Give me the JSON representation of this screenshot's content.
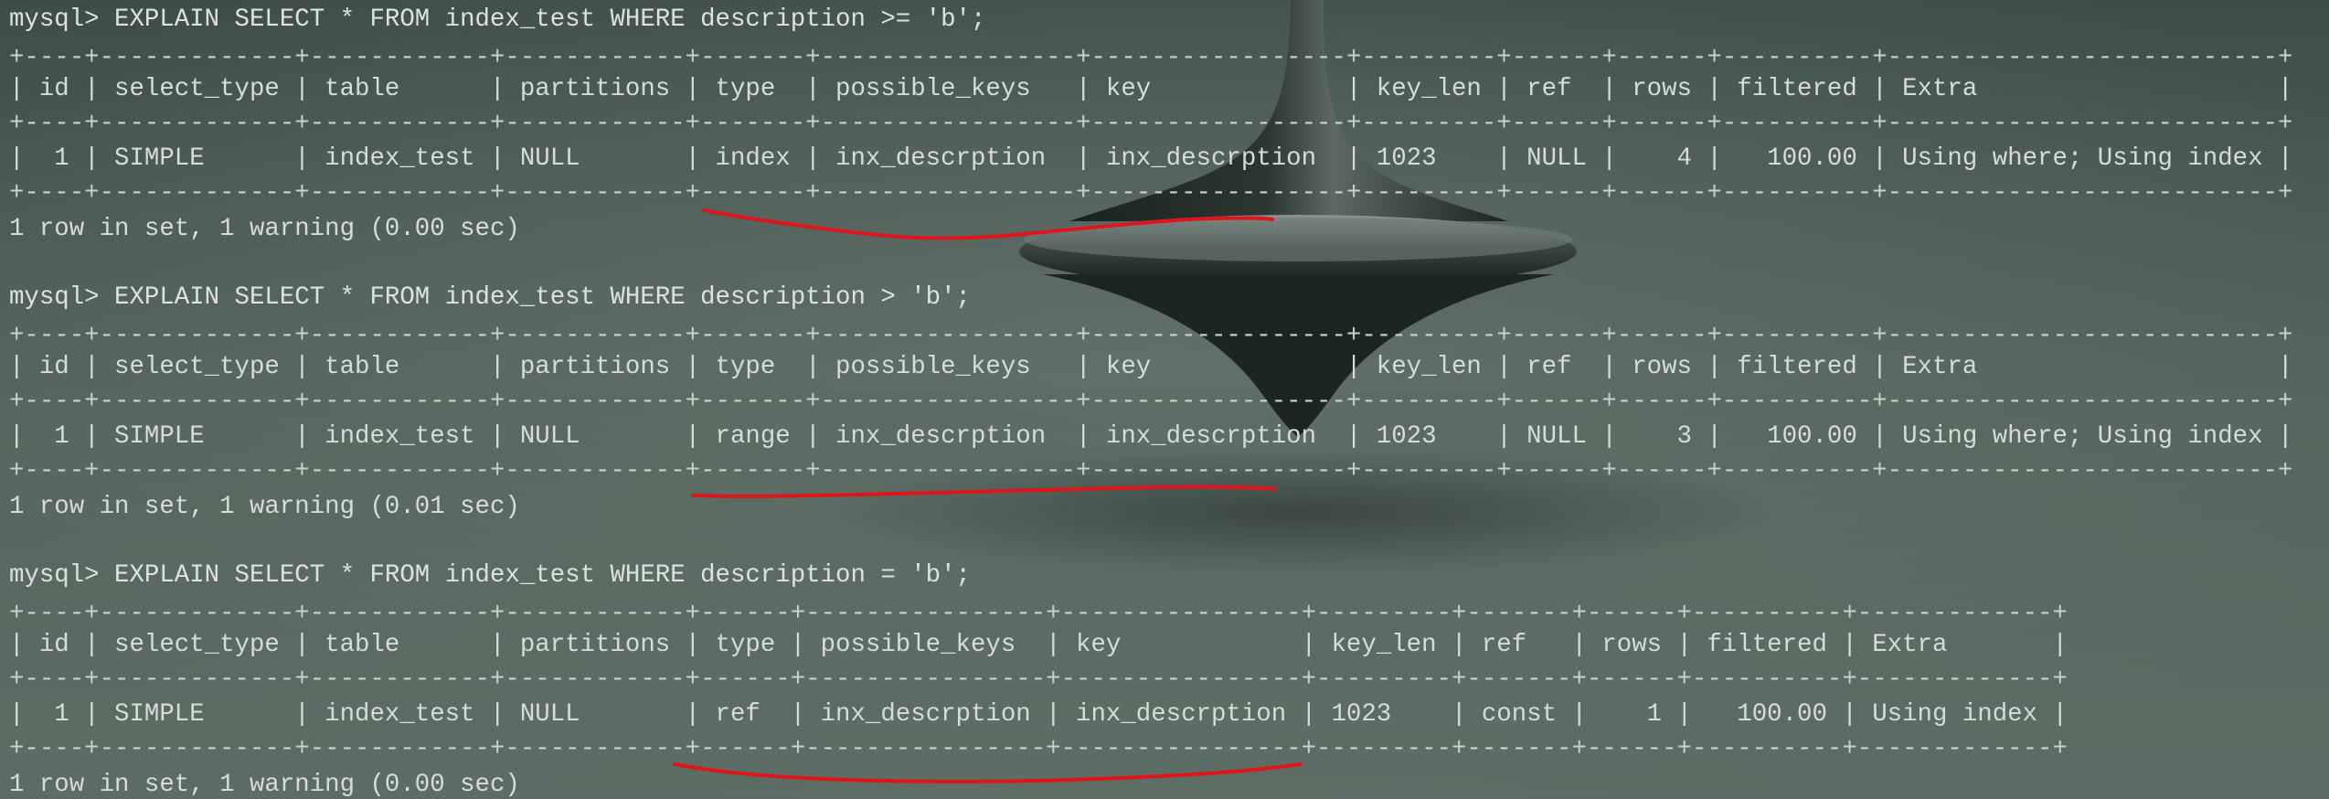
{
  "terminal": {
    "lines": [
      "mysql> EXPLAIN SELECT * FROM index_test WHERE description >= 'b';",
      "+----+-------------+------------+------------+-------+-----------------+-----------------+---------+------+------+----------+--------------------------+",
      "| id | select_type | table      | partitions | type  | possible_keys   | key             | key_len | ref  | rows | filtered | Extra                    |",
      "+----+-------------+------------+------------+-------+-----------------+-----------------+---------+------+------+----------+--------------------------+",
      "|  1 | SIMPLE      | index_test | NULL       | index | inx_descrption  | inx_descrption  | 1023    | NULL |    4 |   100.00 | Using where; Using index |",
      "+----+-------------+------------+------------+-------+-----------------+-----------------+---------+------+------+----------+--------------------------+",
      "1 row in set, 1 warning (0.00 sec)",
      "",
      "mysql> EXPLAIN SELECT * FROM index_test WHERE description > 'b';",
      "+----+-------------+------------+------------+-------+-----------------+-----------------+---------+------+------+----------+--------------------------+",
      "| id | select_type | table      | partitions | type  | possible_keys   | key             | key_len | ref  | rows | filtered | Extra                    |",
      "+----+-------------+------------+------------+-------+-----------------+-----------------+---------+------+------+----------+--------------------------+",
      "|  1 | SIMPLE      | index_test | NULL       | range | inx_descrption  | inx_descrption  | 1023    | NULL |    3 |   100.00 | Using where; Using index |",
      "+----+-------------+------------+------------+-------+-----------------+-----------------+---------+------+------+----------+--------------------------+",
      "1 row in set, 1 warning (0.01 sec)",
      "",
      "mysql> EXPLAIN SELECT * FROM index_test WHERE description = 'b';",
      "+----+-------------+------------+------------+------+----------------+----------------+---------+-------+------+----------+-------------+",
      "| id | select_type | table      | partitions | type | possible_keys  | key            | key_len | ref   | rows | filtered | Extra       |",
      "+----+-------------+------------+------------+------+----------------+----------------+---------+-------+------+----------+-------------+",
      "|  1 | SIMPLE      | index_test | NULL       | ref  | inx_descrption | inx_descrption | 1023    | const |    1 |   100.00 | Using index |",
      "+----+-------------+------------+------------+------+----------------+----------------+---------+-------+------+----------+-------------+",
      "1 row in set, 1 warning (0.00 sec)"
    ]
  },
  "colors": {
    "terminal_text": "#d6dcd8",
    "background": "#4f5f58",
    "annotation_red": "#e0151a"
  }
}
